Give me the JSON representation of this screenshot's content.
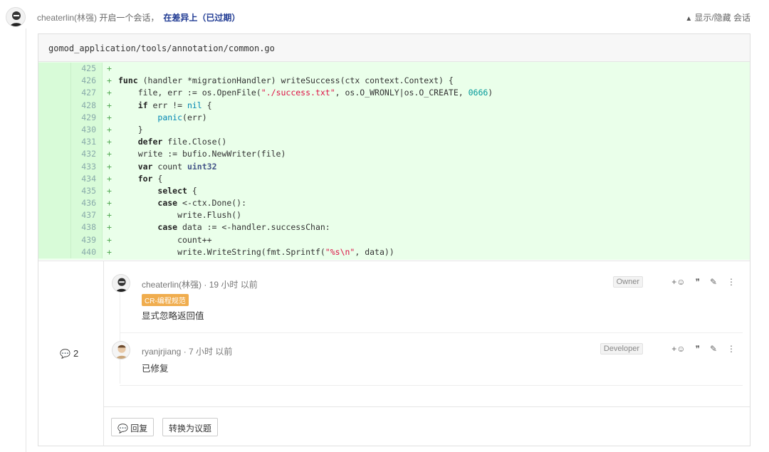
{
  "header": {
    "author": "cheaterlin(林强)",
    "action_text": " 开启一个会话，",
    "link_text": "在差异上（已过期）",
    "toggle_label": "显示/隐藏 会话",
    "toggle_icon": "chevron-up-icon"
  },
  "file": {
    "path": "gomod_application/tools/annotation/common.go"
  },
  "code_lines": [
    {
      "n": "425",
      "sign": "+",
      "html": ""
    },
    {
      "n": "426",
      "sign": "+",
      "html": "<span class=\"kw\">func</span> (handler *migrationHandler) writeSuccess(ctx context.Context) {"
    },
    {
      "n": "427",
      "sign": "+",
      "html": "    file, err := os.OpenFile(<span class=\"str\">\"./success.txt\"</span>, os.O_WRONLY|os.O_CREATE, <span class=\"num\">0666</span>)"
    },
    {
      "n": "428",
      "sign": "+",
      "html": "    <span class=\"kw\">if</span> err != <span class=\"bi\">nil</span> {"
    },
    {
      "n": "429",
      "sign": "+",
      "html": "        <span class=\"bi\">panic</span>(err)"
    },
    {
      "n": "430",
      "sign": "+",
      "html": "    }"
    },
    {
      "n": "431",
      "sign": "+",
      "html": "    <span class=\"kw\">defer</span> file.Close()"
    },
    {
      "n": "432",
      "sign": "+",
      "html": "    write := bufio.NewWriter(file)"
    },
    {
      "n": "433",
      "sign": "+",
      "html": "    <span class=\"kw\">var</span> count <span class=\"ty\">uint32</span>"
    },
    {
      "n": "434",
      "sign": "+",
      "html": "    <span class=\"kw\">for</span> {"
    },
    {
      "n": "435",
      "sign": "+",
      "html": "        <span class=\"kw\">select</span> {"
    },
    {
      "n": "436",
      "sign": "+",
      "html": "        <span class=\"kw\">case</span> &lt;-ctx.Done():"
    },
    {
      "n": "437",
      "sign": "+",
      "html": "            write.Flush()"
    },
    {
      "n": "438",
      "sign": "+",
      "html": "        <span class=\"kw\">case</span> data := &lt;-handler.successChan:"
    },
    {
      "n": "439",
      "sign": "+",
      "html": "            count++"
    },
    {
      "n": "440",
      "sign": "+",
      "html": "            write.WriteString(fmt.Sprintf(<span class=\"str\">\"%s\\n\"</span>, data))"
    }
  ],
  "discussion": {
    "count": "2",
    "notes": [
      {
        "author": "cheaterlin(林强)",
        "time": " · 19 小时 以前",
        "role": "Owner",
        "label": "CR-编程规范",
        "body": "显式忽略返回值"
      },
      {
        "author": "ryanjrjiang",
        "time": " · 7 小时 以前",
        "role": "Developer",
        "label": "",
        "body": "已修复"
      }
    ],
    "actions": {
      "emoji": "+☺",
      "quote": "❞",
      "edit": "✎",
      "more": "⋮"
    },
    "reply_label": "回复",
    "convert_label": "转换为议题"
  }
}
